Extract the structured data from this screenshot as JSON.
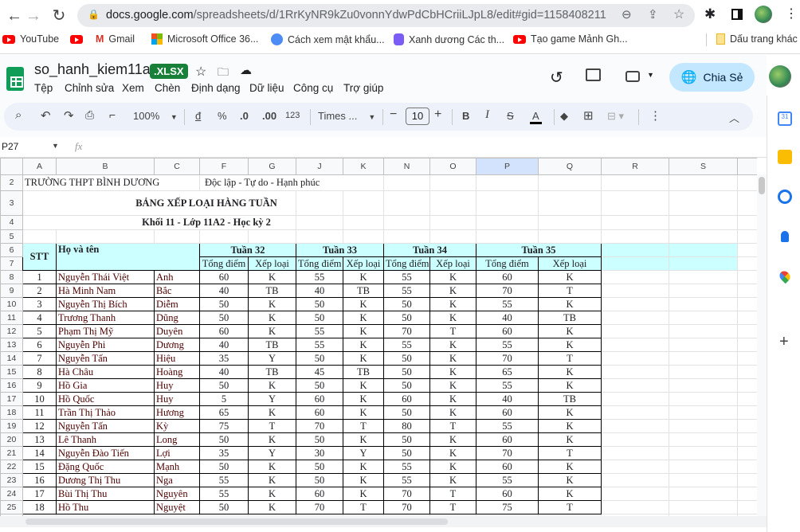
{
  "browser": {
    "url_host": "docs.google.com",
    "url_path": "/spreadsheets/d/1RrKyNR9kZu0vonnYdwPdCbHCriiLJpL8/edit#gid=1158408211",
    "bookmarks": [
      {
        "label": "YouTube",
        "icon": "youtube-icon"
      },
      {
        "label": "Gmail",
        "icon": "gmail-icon"
      },
      {
        "label": "Microsoft Office 36...",
        "icon": "microsoft-icon"
      },
      {
        "label": "Cách xem mật khẩu...",
        "icon": "site-icon"
      },
      {
        "label": "Xanh dương Các th...",
        "icon": "site-icon"
      },
      {
        "label": "Tạo game Mảnh Gh...",
        "icon": "youtube-icon"
      }
    ],
    "other_bookmarks": "Dấu trang khác"
  },
  "doc": {
    "title": "so_hanh_kiem11a2",
    "badge": ".XLSX",
    "share_label": "Chia Sẻ",
    "menu": [
      "Tệp",
      "Chỉnh sửa",
      "Xem",
      "Chèn",
      "Định dạng",
      "Dữ liệu",
      "Công cụ",
      "Trợ giúp"
    ]
  },
  "toolbar": {
    "zoom": "100%",
    "currency": "đ",
    "percent": "%",
    "dec_less": ".0",
    "dec_more": ".00",
    "format_123": "123",
    "font": "Times ...",
    "font_size": "10"
  },
  "formula_bar": {
    "cell_ref": "P27",
    "fx": "fx"
  },
  "columns": [
    "A",
    "B",
    "C",
    "F",
    "G",
    "J",
    "K",
    "N",
    "O",
    "P",
    "Q",
    "R",
    "S"
  ],
  "selected_column": "P",
  "sheet": {
    "school": "TRƯỜNG THPT BÌNH DƯƠNG",
    "motto": "Độc lập - Tự do - Hạnh phúc",
    "title": "BẢNG XẾP LOẠI HÀNG TUẦN",
    "subtitle": "Khối 11 - Lớp 11A2 - Học kỳ 2",
    "h_stt": "STT",
    "h_name": "Họ và tên",
    "weeks": [
      "Tuần 32",
      "Tuần 33",
      "Tuần 34",
      "Tuần 35"
    ],
    "h_score": "Tổng điểm",
    "h_rank": "Xếp loại",
    "rows": [
      [
        "1",
        "Nguyễn Thái Việt",
        "Anh",
        "60",
        "K",
        "55",
        "K",
        "55",
        "K",
        "60",
        "K"
      ],
      [
        "2",
        "Hà Minh Nam",
        "Bắc",
        "40",
        "TB",
        "40",
        "TB",
        "55",
        "K",
        "70",
        "T"
      ],
      [
        "3",
        "Nguyễn Thị Bích",
        "Diễm",
        "50",
        "K",
        "50",
        "K",
        "50",
        "K",
        "55",
        "K"
      ],
      [
        "4",
        "Trương Thanh",
        "Dũng",
        "50",
        "K",
        "50",
        "K",
        "50",
        "K",
        "40",
        "TB"
      ],
      [
        "5",
        "Phạm Thị Mỹ",
        "Duyên",
        "60",
        "K",
        "55",
        "K",
        "70",
        "T",
        "60",
        "K"
      ],
      [
        "6",
        "Nguyễn Phi",
        "Dương",
        "40",
        "TB",
        "55",
        "K",
        "55",
        "K",
        "55",
        "K"
      ],
      [
        "7",
        "Nguyễn Tấn",
        "Hiệu",
        "35",
        "Y",
        "50",
        "K",
        "50",
        "K",
        "70",
        "T"
      ],
      [
        "8",
        "Hà Châu",
        "Hoàng",
        "40",
        "TB",
        "45",
        "TB",
        "50",
        "K",
        "65",
        "K"
      ],
      [
        "9",
        "Hồ Gia",
        "Huy",
        "50",
        "K",
        "50",
        "K",
        "50",
        "K",
        "55",
        "K"
      ],
      [
        "10",
        "Hồ Quốc",
        "Huy",
        "5",
        "Y",
        "60",
        "K",
        "60",
        "K",
        "40",
        "TB"
      ],
      [
        "11",
        "Trần Thị Thảo",
        "Hương",
        "65",
        "K",
        "60",
        "K",
        "50",
        "K",
        "60",
        "K"
      ],
      [
        "12",
        "Nguyễn Tấn",
        "Kỳ",
        "75",
        "T",
        "70",
        "T",
        "80",
        "T",
        "55",
        "K"
      ],
      [
        "13",
        "Lê Thanh",
        "Long",
        "50",
        "K",
        "50",
        "K",
        "50",
        "K",
        "60",
        "K"
      ],
      [
        "14",
        "Nguyễn Đào Tiến",
        "Lợi",
        "35",
        "Y",
        "30",
        "Y",
        "50",
        "K",
        "70",
        "T"
      ],
      [
        "15",
        "Đặng Quốc",
        "Mạnh",
        "50",
        "K",
        "50",
        "K",
        "55",
        "K",
        "60",
        "K"
      ],
      [
        "16",
        "Dương Thị Thu",
        "Nga",
        "55",
        "K",
        "50",
        "K",
        "55",
        "K",
        "55",
        "K"
      ],
      [
        "17",
        "Bùi Thị Thu",
        "Nguyên",
        "55",
        "K",
        "60",
        "K",
        "70",
        "T",
        "60",
        "K"
      ],
      [
        "18",
        "Hồ Thu",
        "Nguyệt",
        "50",
        "K",
        "70",
        "T",
        "70",
        "T",
        "75",
        "T"
      ]
    ]
  },
  "colors": {
    "header_fill": "#ccffff",
    "share": "#c2e7ff",
    "badge": "#188038",
    "selected_col": "#d3e3fd"
  }
}
